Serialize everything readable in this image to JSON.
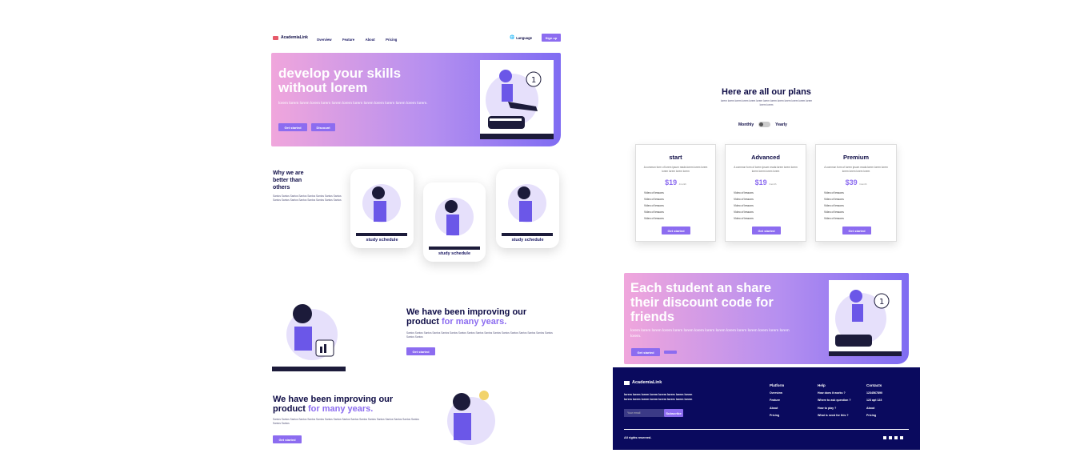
{
  "brand": "AcademiaLink",
  "nav": {
    "overview": "Overview",
    "feature": "Feature",
    "about": "About",
    "pricing": "Pricing",
    "language": "Language",
    "signup": "Sign up"
  },
  "hero": {
    "title": "develop your skills without lorem",
    "body": "lorem lorem lorem lorem lorem  lorem lorem lorem lorem lorem lorem lorem lorem lorem.",
    "get_started": "Get started",
    "discount": "Discount"
  },
  "why": {
    "title": "Why we are better than others",
    "body": "Santos Santos Santos Santos Santos Santos Santos Santos Santos Santos Santos Santos Santos Santos Santos Santos",
    "cards": [
      "study schedule",
      "study schedule",
      "study schedule"
    ]
  },
  "improve1": {
    "title_a": "We have been improving our product",
    "title_b": "for many years.",
    "body": "Santos Santos Santos Santos Santos Santos Santos Santos Santos Santos Santos Santos Santos Santos Santos Santos Santos Santos Santos",
    "cta": "Get started"
  },
  "improve2": {
    "title_a": "We have been improving our product",
    "title_b": "for many years.",
    "body": "Santos Santos Santos Santos Santos Santos Santos Santos Santos Santos Santos Santos Santos Santos Santos Santos Santos Santos Santos",
    "cta": "Get started"
  },
  "plans": {
    "title": "Here are all our plans",
    "subtitle": "lorem lorem lorem lorem lorem lorem lorem lorem lorem lorem lorem lorem lorem lorem lorem",
    "monthly": "Monthly",
    "yearly": "Yearly",
    "items": [
      {
        "name": "start",
        "desc": "A common form of lorem ipsum reads:lorem lorem lorem lorem lorem lorem lorem",
        "price": "$19",
        "per": "/month",
        "features": [
          "Video of lessons",
          "Video of lessons",
          "Video of lessons",
          "Video of lessons",
          "Video of lessons"
        ],
        "cta": "Get started"
      },
      {
        "name": "Advanced",
        "desc": "A common form of lorem ipsum reads:lorem lorem lorem lorem lorem lorem lorem",
        "price": "$19",
        "per": "/month",
        "features": [
          "Video of lessons",
          "Video of lessons",
          "Video of lessons",
          "Video of lessons",
          "Video of lessons"
        ],
        "cta": "Get started"
      },
      {
        "name": "Premium",
        "desc": "A common form of lorem ipsum reads:lorem lorem lorem lorem lorem lorem lorem",
        "price": "$39",
        "per": "/month",
        "features": [
          "Video of lessons",
          "Video of lessons",
          "Video of lessons",
          "Video of lessons",
          "Video of lessons"
        ],
        "cta": "Get started"
      }
    ]
  },
  "share": {
    "title": "Each student an share their discount code for friends",
    "body": "lorem lorem lorem lorem  lorem lorem lorem lorem lorem lorem lorem lorem lorem lorem lorem lorem.",
    "cta": "Get started"
  },
  "footer": {
    "tagline": "lorem lorem lorem lorem lorem lorem lorem lorem lorem lorem lorem lorem lorem lorem lorem lorem",
    "email_placeholder": "Your email",
    "subscribe": "Subscribe",
    "platform": {
      "title": "Platform",
      "links": [
        "Overview",
        "Feature",
        "About",
        "Pricing"
      ]
    },
    "help": {
      "title": "Help",
      "links": [
        "How does it works ?",
        "Where to ask question ?",
        "How to play ?",
        "What is need for this ?"
      ]
    },
    "contacts": {
      "title": "Contacts",
      "links": [
        "1234567890",
        "123 apt 123",
        "About",
        "Pricing"
      ]
    },
    "rights": "All rights reserved."
  },
  "colors": {
    "navy": "#0a0a5e",
    "purple": "#8c6cf0",
    "pink": "#f0a6dc"
  }
}
